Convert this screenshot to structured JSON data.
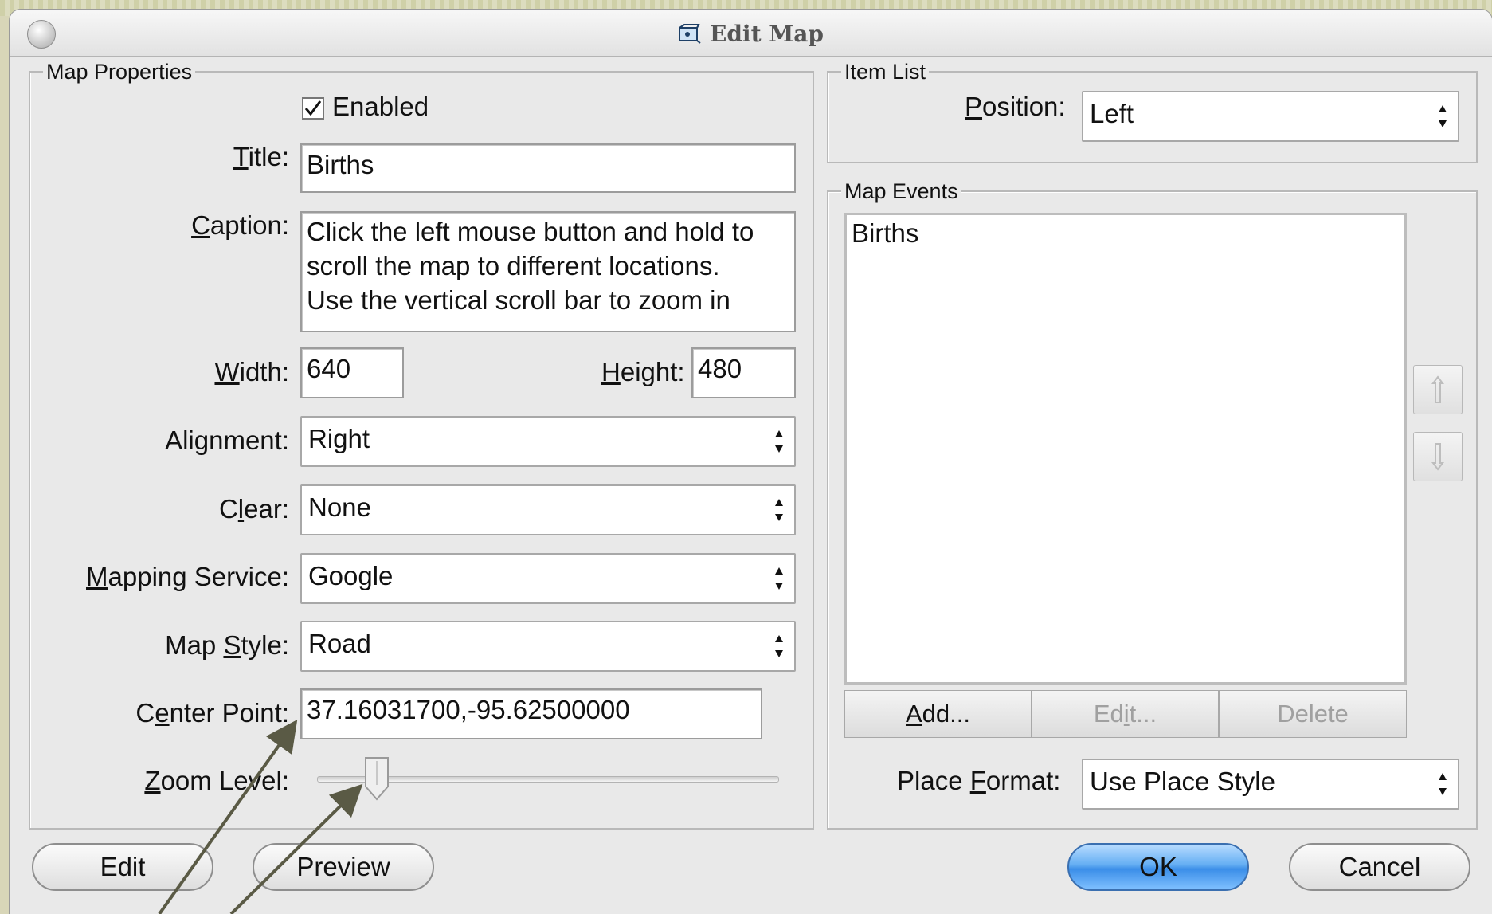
{
  "window": {
    "title": "Edit Map"
  },
  "map_properties": {
    "legend": "Map Properties",
    "enabled": {
      "label": "Enabled",
      "checked": true
    },
    "title": {
      "label": "itle:",
      "label_underlined": "T",
      "value": "Births"
    },
    "caption": {
      "label": "aption:",
      "label_underlined": "C",
      "lines": [
        "Click the left mouse button and hold to",
        "scroll the map to different locations.",
        "Use the vertical scroll bar to zoom in"
      ]
    },
    "width": {
      "label": "idth:",
      "label_underlined": "W",
      "value": "640"
    },
    "height": {
      "label": "eight:",
      "label_underlined": "H",
      "value": "480"
    },
    "alignment": {
      "label": "Alignment:",
      "value": "Right"
    },
    "clear": {
      "label_pre": "C",
      "label_underlined": "l",
      "label_post": "ear:",
      "value": "None"
    },
    "mapping_service": {
      "label": "apping Service:",
      "label_underlined": "M",
      "value": "Google"
    },
    "map_style": {
      "label_pre": "Map ",
      "label_underlined": "S",
      "label_post": "tyle:",
      "value": "Road"
    },
    "center_point": {
      "label_pre": "C",
      "label_underlined": "e",
      "label_post": "nter Point:",
      "value": "37.16031700,-95.62500000"
    },
    "zoom_level": {
      "label": "oom Level:",
      "label_underlined": "Z",
      "level_fraction": 0.13
    }
  },
  "item_list": {
    "legend": "Item List",
    "position": {
      "label": "osition:",
      "label_underlined": "P",
      "value": "Left"
    }
  },
  "map_events": {
    "legend": "Map Events",
    "items": [
      "Births"
    ],
    "add_pre": "",
    "add_underlined": "A",
    "add_post": "dd...",
    "edit_pre": "Ed",
    "edit_underlined": "i",
    "edit_post": "t...",
    "delete_label": "Delete",
    "place_format": {
      "label_pre": "Place ",
      "label_underlined": "F",
      "label_post": "ormat:",
      "value": "Use Place Style"
    }
  },
  "buttons": {
    "edit": "Edit",
    "preview": "Preview",
    "ok": "OK",
    "cancel": "Cancel"
  },
  "colors": {
    "annotation_arrow": "#5a5a45",
    "ok_button": "#4a9cf0"
  }
}
